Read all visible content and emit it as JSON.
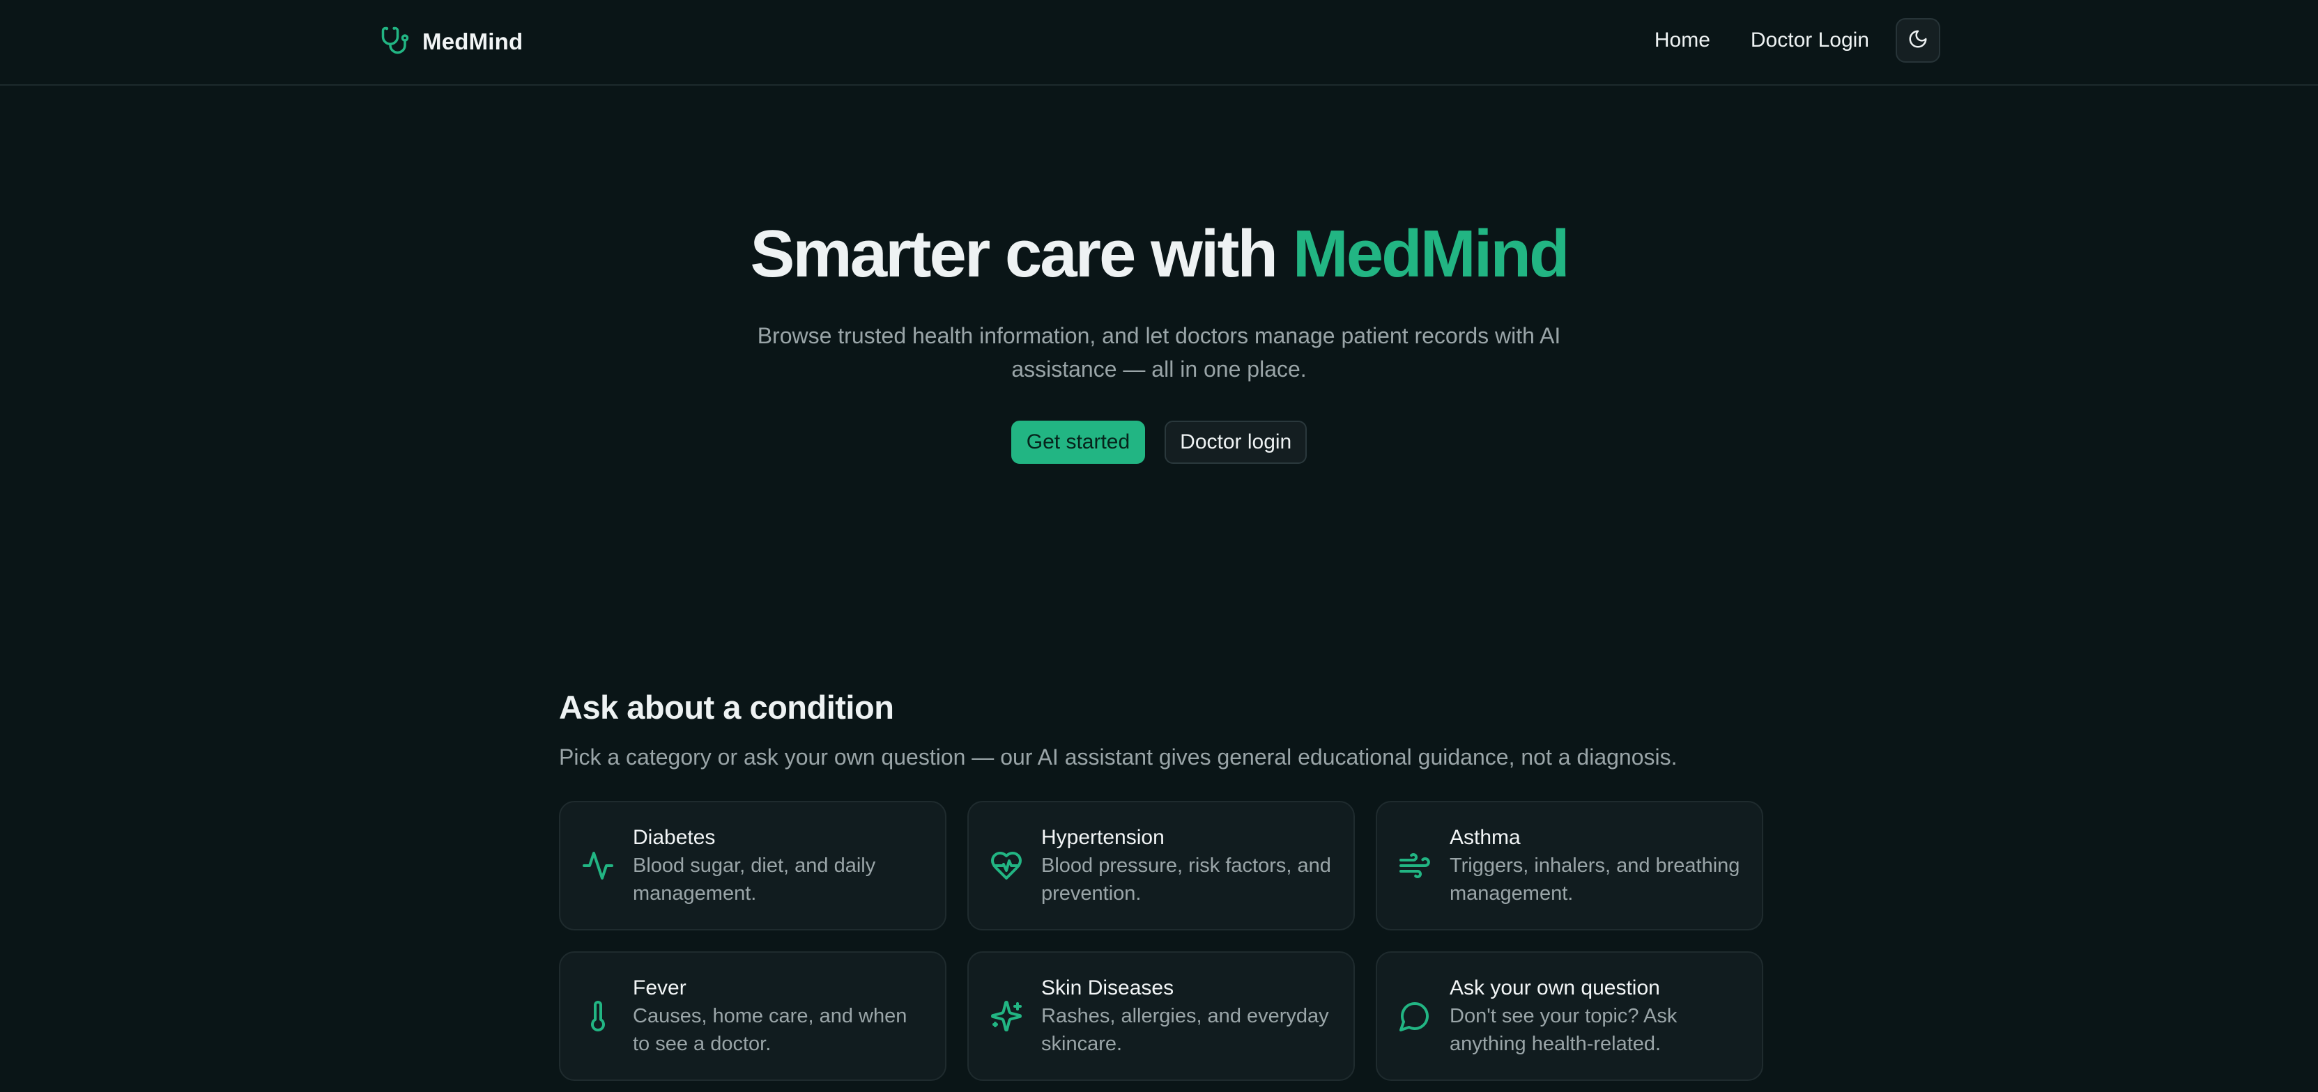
{
  "nav": {
    "brand": "MedMind",
    "brand_icon": "stethoscope-icon",
    "links": [
      "Home",
      "Doctor Login"
    ],
    "theme_icon": "moon-icon"
  },
  "hero": {
    "title_prefix": "Smarter care with ",
    "title_accent": "MedMind",
    "subtitle": "Browse trusted health information, and let doctors manage patient records with AI assistance — all in one place.",
    "primary_cta": "Get started",
    "secondary_cta": "Doctor login"
  },
  "conditions": {
    "title": "Ask about a condition",
    "subtitle": "Pick a category or ask your own question — our AI assistant gives general educational guidance, not a diagnosis.",
    "cards": [
      {
        "title": "Diabetes",
        "desc": "Blood sugar, diet, and daily management.",
        "icon": "activity-icon"
      },
      {
        "title": "Hypertension",
        "desc": "Blood pressure, risk factors, and prevention.",
        "icon": "heart-pulse-icon"
      },
      {
        "title": "Asthma",
        "desc": "Triggers, inhalers, and breathing management.",
        "icon": "wind-icon"
      },
      {
        "title": "Fever",
        "desc": "Causes, home care, and when to see a doctor.",
        "icon": "thermometer-icon"
      },
      {
        "title": "Skin Diseases",
        "desc": "Rashes, allergies, and everyday skincare.",
        "icon": "sparkles-icon"
      },
      {
        "title": "Ask your own question",
        "desc": "Don't see your topic? Ask anything health-related.",
        "icon": "chat-bubble-icon"
      }
    ]
  },
  "colors": {
    "background": "#0a1517",
    "accent": "#22b583",
    "card": "#111c1f",
    "muted_text": "#9aa5a8"
  }
}
